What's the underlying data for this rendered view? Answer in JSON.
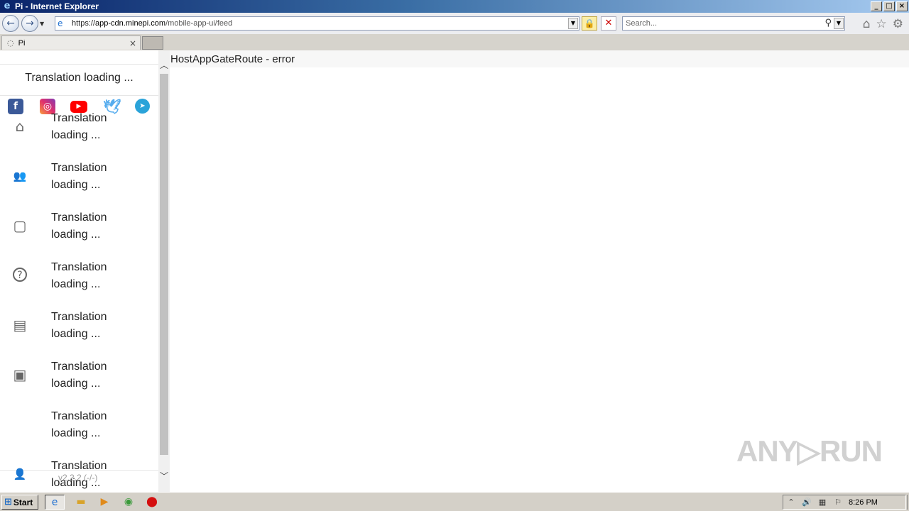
{
  "window": {
    "title": "Pi - Internet Explorer",
    "logo_icon": "ie-icon",
    "buttons": {
      "minimize": "_",
      "maximize": "□",
      "close": "×"
    }
  },
  "navigation": {
    "back_icon": "back-arrow-icon",
    "forward_icon": "forward-arrow-icon",
    "url_scheme": "https://",
    "url_host": "app-cdn.minepi.com",
    "url_path": "/mobile-app-ui/feed",
    "search_placeholder": "Search...",
    "lock_icon": "lock-icon",
    "stop_icon": "stop-icon",
    "toolbar_icons": [
      "home-icon",
      "favorites-star-icon",
      "settings-gear-icon"
    ]
  },
  "tabs": [
    {
      "label": "Pi",
      "state": "loading"
    }
  ],
  "sidebar": {
    "title": "Translation loading ...",
    "social": [
      {
        "name": "facebook",
        "glyph": "f"
      },
      {
        "name": "instagram",
        "glyph": "◎"
      },
      {
        "name": "youtube",
        "glyph": "▶"
      },
      {
        "name": "twitter",
        "glyph": "🕊"
      },
      {
        "name": "telegram",
        "glyph": "➤"
      }
    ],
    "items": [
      {
        "icon": "home-icon",
        "glyph": "⌂",
        "line1": "Translation",
        "line2": "loading ..."
      },
      {
        "icon": "people-icon",
        "glyph": "👥",
        "line1": "Translation",
        "line2": "loading ..."
      },
      {
        "icon": "chat-bubble-icon",
        "glyph": "▢",
        "line1": "Translation",
        "line2": "loading ..."
      },
      {
        "icon": "help-circle-icon",
        "glyph": "?",
        "line1": "Translation",
        "line2": "loading ..."
      },
      {
        "icon": "document-icon",
        "glyph": "▤",
        "line1": "Translation",
        "line2": "loading ..."
      },
      {
        "icon": "forum-icon",
        "glyph": "▣",
        "line1": "Translation",
        "line2": "loading ..."
      },
      {
        "icon": "",
        "glyph": "",
        "line1": "Translation",
        "line2": "loading ..."
      },
      {
        "icon": "person-icon",
        "glyph": "👤",
        "line1": "Translation",
        "line2": "loading ..."
      }
    ],
    "version": "v2.2.2 (-/-)"
  },
  "content": {
    "message": "HostAppGateRoute - error"
  },
  "watermark": "ANY▷RUN",
  "taskbar": {
    "start_label": "Start",
    "apps": [
      "ie-icon",
      "folder-icon",
      "media-player-icon",
      "chrome-icon",
      "opera-icon"
    ],
    "tray_icons": [
      "show-hidden-icon",
      "volume-icon",
      "network-icon",
      "flag-icon"
    ],
    "time": "8:26 PM"
  }
}
